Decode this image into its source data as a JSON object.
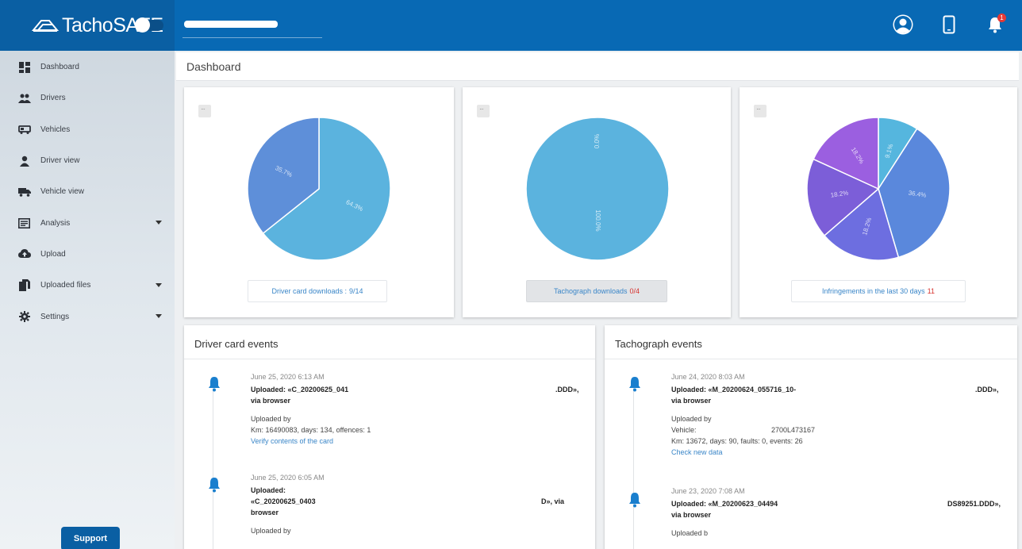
{
  "app": {
    "brand_name": "TachoSAFE",
    "company_name": ""
  },
  "topbar": {
    "icons": [
      "account-icon",
      "tablet-icon",
      "notification-bell-icon"
    ],
    "notification_count": "1"
  },
  "sidebar": {
    "items": [
      {
        "label": "Dashboard",
        "icon": "dashboard-icon",
        "caret": false
      },
      {
        "label": "Drivers",
        "icon": "drivers-icon",
        "caret": false
      },
      {
        "label": "Vehicles",
        "icon": "vehicles-icon",
        "caret": false
      },
      {
        "label": "Driver view",
        "icon": "driver-view-icon",
        "caret": false
      },
      {
        "label": "Vehicle view",
        "icon": "vehicle-view-icon",
        "caret": false
      },
      {
        "label": "Analysis",
        "icon": "analysis-icon",
        "caret": true
      },
      {
        "label": "Upload",
        "icon": "upload-icon",
        "caret": false
      },
      {
        "label": "Uploaded files",
        "icon": "uploaded-files-icon",
        "caret": true
      },
      {
        "label": "Settings",
        "icon": "settings-icon",
        "caret": true
      }
    ],
    "support_label": "Support"
  },
  "page": {
    "title": "Dashboard"
  },
  "charts": {
    "driver_card": {
      "button_label": "Driver card downloads :",
      "button_value": "9/14",
      "slices": [
        {
          "label": "64.3%",
          "value": 64.3,
          "color": "#5bb3de"
        },
        {
          "label": "35.7%",
          "value": 35.7,
          "color": "#5e8fd9"
        }
      ]
    },
    "tachograph": {
      "button_label": "Tachograph downloads",
      "button_value": "0/4",
      "slices": [
        {
          "label": "100.0%",
          "value": 100.0,
          "color": "#5bb3de"
        },
        {
          "label": "0.0%",
          "value": 0.0,
          "color": "#5e8fd9"
        }
      ]
    },
    "infringements": {
      "button_label": "Infringements in the last 30 days",
      "button_value": "11",
      "slices": [
        {
          "label": "9.1%",
          "value": 9.1,
          "color": "#55b6de"
        },
        {
          "label": "36.4%",
          "value": 36.4,
          "color": "#5a88dc"
        },
        {
          "label": "18.2%",
          "value": 18.2,
          "color": "#6d6ee0"
        },
        {
          "label": "18.2%",
          "value": 18.2,
          "color": "#7c5ed8"
        },
        {
          "label": "18.2%",
          "value": 18.2,
          "color": "#9b5fe0"
        }
      ]
    }
  },
  "driver_events": {
    "title": "Driver card events",
    "items": [
      {
        "date": "June 25, 2020 6:13 AM",
        "title_1": "Uploaded: «C_20200625_041",
        "title_tail": ".DDD»,",
        "title_2": "via browser",
        "line_1": "Uploaded by",
        "line_2": "Km: 16490083, days: 134, offences: 1",
        "link": "Verify contents of the card"
      },
      {
        "date": "June 25, 2020 6:05 AM",
        "title_1": "Uploaded:",
        "title_2": "«C_20200625_0403",
        "title_tail": "D», via",
        "title_3": "browser",
        "line_1": "Uploaded by"
      }
    ]
  },
  "tacho_events": {
    "title": "Tachograph events",
    "items": [
      {
        "date": "June 24, 2020 8:03 AM",
        "title_1": "Uploaded: «M_20200624_055716_10-",
        "title_tail": ".DDD»,",
        "title_2": "via browser",
        "line_1": "Uploaded by",
        "line_2": "Vehicle:",
        "line_2_tail": "2700L473167",
        "line_3": "Km: 13672, days: 90, faults: 0, events: 26",
        "link": "Check new data"
      },
      {
        "date": "June 23, 2020 7:08 AM",
        "title_1": "Uploaded: «M_20200623_04494",
        "title_tail": "DS89251.DDD»,",
        "title_2": "via browser",
        "line_1": "Uploaded b"
      }
    ]
  }
}
